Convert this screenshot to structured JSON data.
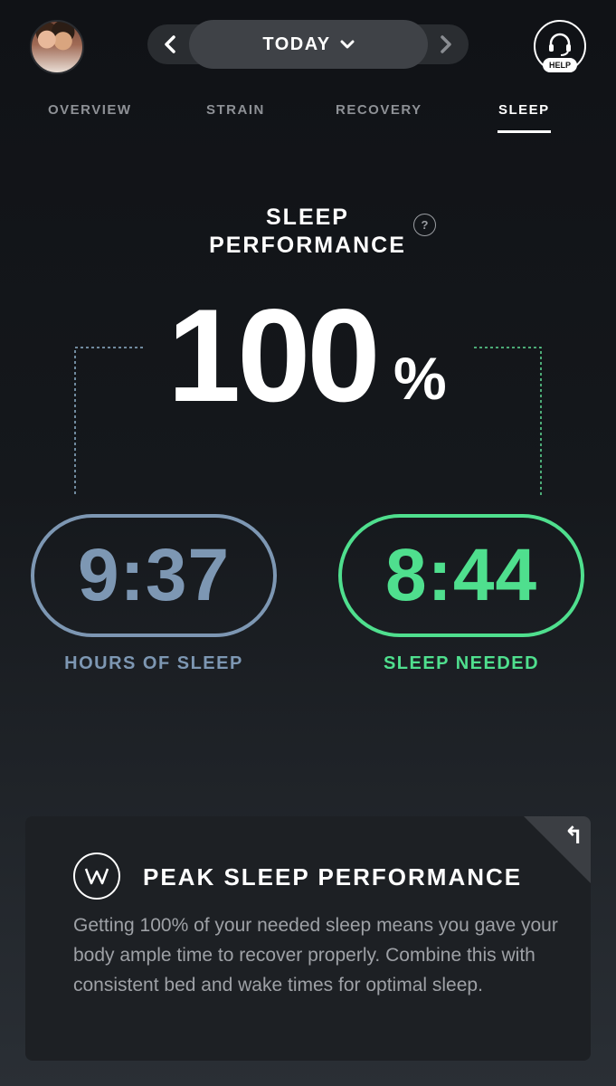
{
  "header": {
    "date_label": "TODAY",
    "prev_icon": "chevron-left-icon",
    "next_icon": "chevron-right-icon",
    "dropdown_icon": "chevron-down-icon",
    "help_label": "HELP"
  },
  "tabs": [
    {
      "label": "OVERVIEW",
      "active": false
    },
    {
      "label": "STRAIN",
      "active": false
    },
    {
      "label": "RECOVERY",
      "active": false
    },
    {
      "label": "SLEEP",
      "active": true
    }
  ],
  "sleep_performance": {
    "title_line1": "SLEEP",
    "title_line2": "PERFORMANCE",
    "info_icon": "?",
    "value": "100",
    "unit": "%"
  },
  "hours_of_sleep": {
    "value": "9:37",
    "label": "HOURS OF SLEEP",
    "color": "#7d97b3"
  },
  "sleep_needed": {
    "value": "8:44",
    "label": "SLEEP NEEDED",
    "color": "#4fdf8e"
  },
  "card": {
    "title": "PEAK SLEEP PERFORMANCE",
    "logo": "W",
    "body": "Getting 100% of your needed sleep means you gave your body ample time to recover properly. Combine this with consistent bed and wake times for optimal sleep."
  }
}
